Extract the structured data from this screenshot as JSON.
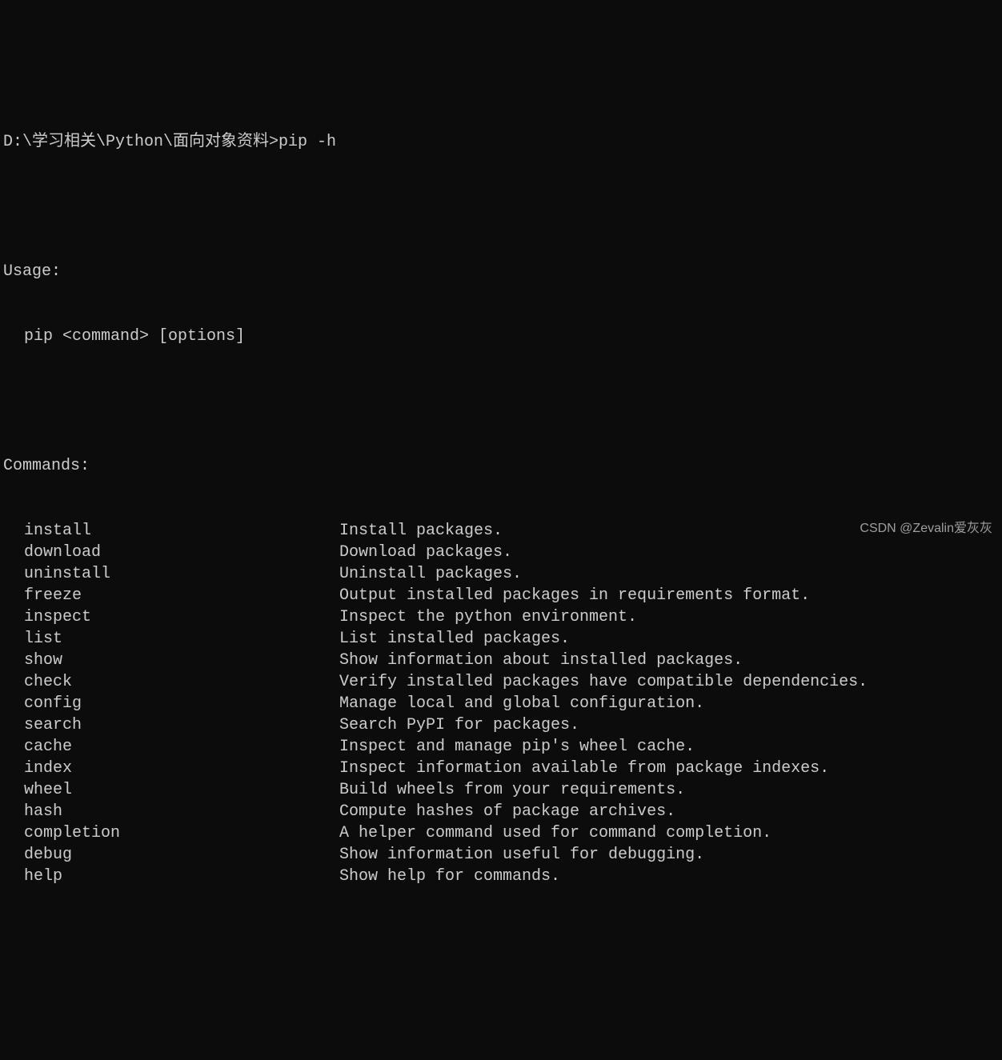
{
  "prompt": {
    "path": "D:\\学习相关\\Python\\面向对象资料>",
    "command": "pip -h"
  },
  "usage": {
    "header": "Usage:",
    "line": "pip <command> [options]"
  },
  "commands_header": "Commands:",
  "commands": [
    {
      "name": "install",
      "desc": "Install packages."
    },
    {
      "name": "download",
      "desc": "Download packages."
    },
    {
      "name": "uninstall",
      "desc": "Uninstall packages."
    },
    {
      "name": "freeze",
      "desc": "Output installed packages in requirements format."
    },
    {
      "name": "inspect",
      "desc": "Inspect the python environment."
    },
    {
      "name": "list",
      "desc": "List installed packages."
    },
    {
      "name": "show",
      "desc": "Show information about installed packages."
    },
    {
      "name": "check",
      "desc": "Verify installed packages have compatible dependencies."
    },
    {
      "name": "config",
      "desc": "Manage local and global configuration."
    },
    {
      "name": "search",
      "desc": "Search PyPI for packages."
    },
    {
      "name": "cache",
      "desc": "Inspect and manage pip's wheel cache."
    },
    {
      "name": "index",
      "desc": "Inspect information available from package indexes."
    },
    {
      "name": "wheel",
      "desc": "Build wheels from your requirements."
    },
    {
      "name": "hash",
      "desc": "Compute hashes of package archives."
    },
    {
      "name": "completion",
      "desc": "A helper command used for command completion."
    },
    {
      "name": "debug",
      "desc": "Show information useful for debugging."
    },
    {
      "name": "help",
      "desc": "Show help for commands."
    }
  ],
  "watermark": "CSDN @Zevalin爱灰灰"
}
